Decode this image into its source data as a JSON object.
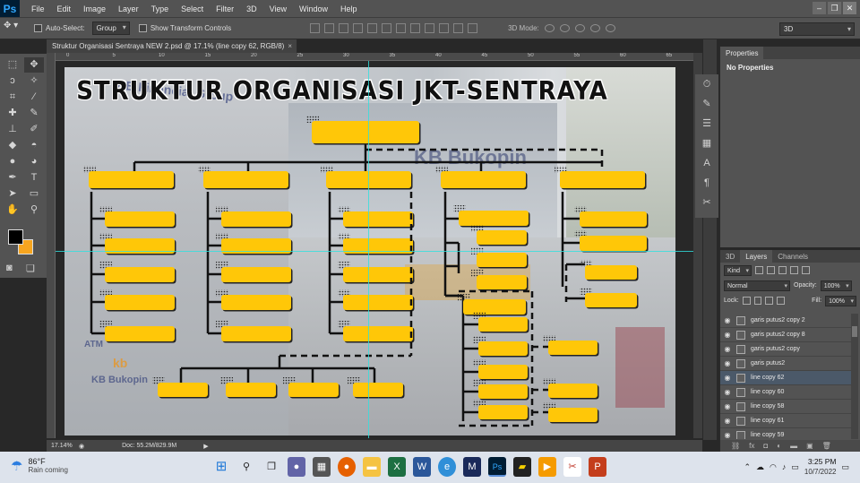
{
  "app": {
    "logo": "Ps",
    "menus": [
      "File",
      "Edit",
      "Image",
      "Layer",
      "Type",
      "Select",
      "Filter",
      "3D",
      "View",
      "Window",
      "Help"
    ]
  },
  "options_bar": {
    "auto_select_label": "Auto-Select:",
    "auto_select_value": "Group",
    "transform_label": "Show Transform Controls",
    "mode3d_label": "3D Mode:",
    "workspace": "3D"
  },
  "document": {
    "tab_title": "Struktur Organisasi Sentraya NEW 2.psd @ 17.1% (line copy 62, RGB/8)",
    "tab_close": "×",
    "ruler_numbers": [
      "0",
      "5",
      "10",
      "15",
      "20",
      "25",
      "30",
      "35",
      "40",
      "45",
      "50",
      "55",
      "60",
      "65"
    ],
    "zoom": "17.14%",
    "doc_size": "Doc: 55.2M/829.9M"
  },
  "artwork": {
    "title": "STRUKTUR ORGANISASI JKT-SENTRAYA",
    "photo_signs": {
      "kb_group": "KB Financial Group",
      "kb_bukopin_top": "KB Bukopin",
      "atm": "ATM",
      "kb_logo": "kb",
      "kb_bukopin_bottom": "KB Bukopin"
    }
  },
  "properties_panel": {
    "tab": "Properties",
    "body": "No Properties"
  },
  "layers_panel": {
    "tabs": [
      "3D",
      "Layers",
      "Channels"
    ],
    "kind_filter": "Kind",
    "blend_mode": "Normal",
    "opacity_label": "Opacity:",
    "opacity_value": "100%",
    "lock_label": "Lock:",
    "fill_label": "Fill:",
    "fill_value": "100%",
    "layers": [
      {
        "name": "garis putus2 copy 2",
        "selected": false
      },
      {
        "name": "garis putus2 copy 8",
        "selected": false
      },
      {
        "name": "garis putus2 copy",
        "selected": false
      },
      {
        "name": "garis putus2",
        "selected": false
      },
      {
        "name": "line copy 62",
        "selected": true
      },
      {
        "name": "line copy 60",
        "selected": false
      },
      {
        "name": "line copy 58",
        "selected": false
      },
      {
        "name": "line copy 61",
        "selected": false
      },
      {
        "name": "line copy 59",
        "selected": false
      }
    ]
  },
  "taskbar": {
    "weather_temp": "86°F",
    "weather_cond": "Rain coming",
    "time": "3:25 PM",
    "date": "10/7/2022"
  },
  "colors": {
    "box_fill": "#ffc708",
    "line": "#111111",
    "guide": "#30e0e0",
    "foreground": "#000000",
    "background": "#f7a51f"
  }
}
